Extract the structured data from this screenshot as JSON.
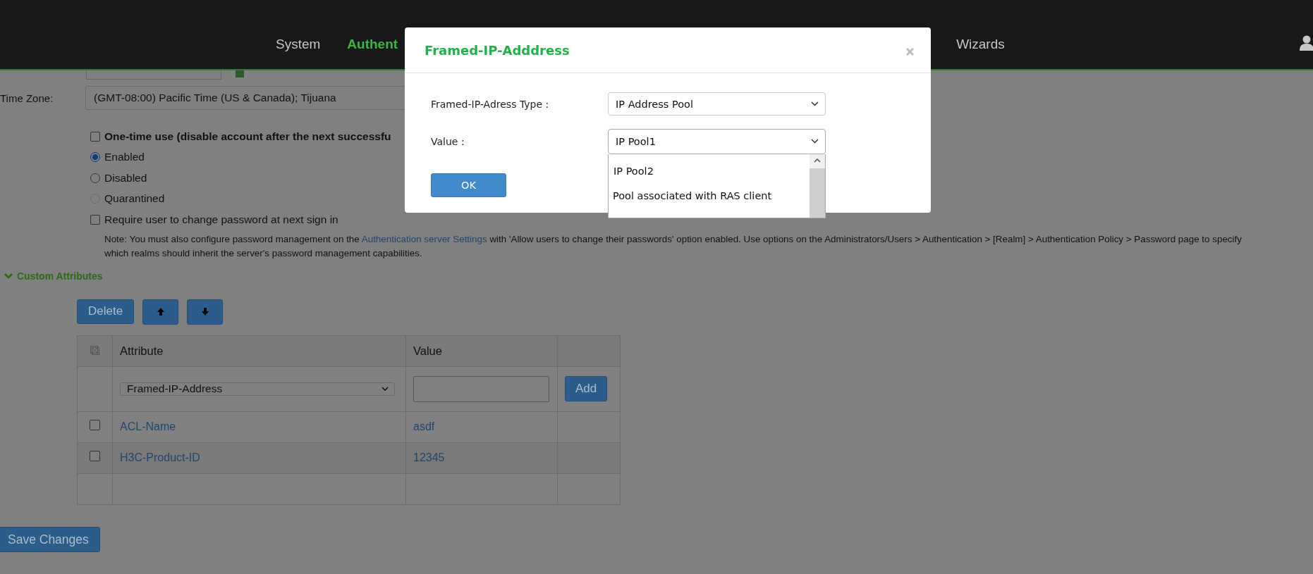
{
  "top_nav": {
    "items": [
      {
        "label": "System",
        "active": false
      },
      {
        "label": "Authent",
        "active": true
      },
      {
        "label": "Wizards",
        "active": false
      }
    ]
  },
  "form": {
    "time_zone": {
      "label": "Time Zone:",
      "value": "(GMT-08:00) Pacific Time (US & Canada); Tijuana"
    },
    "one_time_use": {
      "label": "One-time use (disable account after the next successfu",
      "checked": false
    },
    "status_options": [
      {
        "label": "Enabled",
        "selected": true,
        "disabled": false
      },
      {
        "label": "Disabled",
        "selected": false,
        "disabled": false
      },
      {
        "label": "Quarantined",
        "selected": false,
        "disabled": true
      }
    ],
    "require_password_change": {
      "label": "Require user to change password at next sign in",
      "checked": false
    },
    "note": {
      "before": "Note: You must also configure password management on the ",
      "link": "Authentication server Settings",
      "after": " with 'Allow users to change their passwords' option enabled. Use options on the Administrators/Users > Authentication > [Realm] > Authentication Policy > Password page to specify which realms should inherit the server's password management capabilities."
    }
  },
  "custom_attributes": {
    "title": "Custom Attributes",
    "expanded": true,
    "buttons": [
      {
        "kind": "text",
        "label": "Delete"
      },
      {
        "kind": "up"
      },
      {
        "kind": "down"
      }
    ],
    "table": {
      "columns": [
        "Attribute",
        "Value"
      ],
      "new_row": {
        "attribute": "Framed-IP-Address",
        "add_label": "Add"
      },
      "rows": [
        {
          "attribute": "ACL-Name",
          "value": "asdf",
          "checked": false
        },
        {
          "attribute": "H3C-Product-ID",
          "value": "12345",
          "checked": false
        }
      ]
    }
  },
  "save_button": "Save Changes",
  "dialog": {
    "title": "Framed-IP-Adddress",
    "fields": [
      {
        "label": "Framed-IP-Adress Type :",
        "value": "IP Address Pool",
        "expanded": false
      },
      {
        "label": "Value :",
        "value": "IP Pool1",
        "expanded": true,
        "options": [
          "IP Pool2",
          "Pool associated with RAS client"
        ]
      }
    ],
    "ok_label": "OK"
  }
}
